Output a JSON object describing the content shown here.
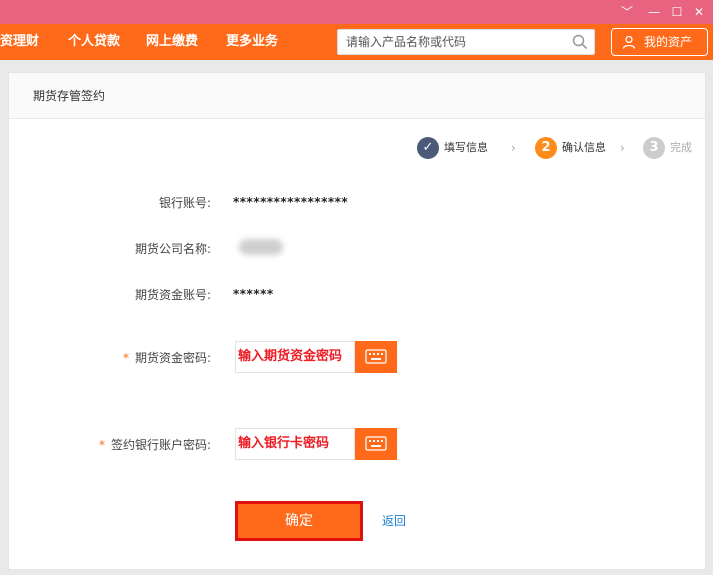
{
  "window": {
    "minimize": "﹀",
    "minimize2": "—",
    "maximize": "☐",
    "close": "✕"
  },
  "nav": {
    "items": [
      "资理财",
      "个人贷款",
      "网上缴费",
      "更多业务"
    ],
    "search_placeholder": "请输入产品名称或代码",
    "my_assets": "我的资产"
  },
  "page": {
    "section_title": "期货存管签约",
    "steps": [
      {
        "label": "填写信息",
        "state": "done",
        "symbol": "✓"
      },
      {
        "label": "确认信息",
        "state": "current",
        "symbol": "2"
      },
      {
        "label": "完成",
        "state": "pending",
        "symbol": "3"
      }
    ],
    "step_arrow": "›",
    "fields": [
      {
        "label": "银行账号:",
        "value": "*****************"
      },
      {
        "label": "期货公司名称:",
        "value": ""
      },
      {
        "label": "期货资金账号:",
        "value": "******"
      }
    ],
    "password_fields": [
      {
        "required_mark": "*",
        "label": "期货资金密码:",
        "placeholder": "输入期货资金密码"
      },
      {
        "required_mark": "*",
        "label": "签约银行账户密码:",
        "placeholder": "输入银行卡密码"
      }
    ],
    "confirm_label": "确定",
    "back_label": "返回"
  },
  "colors": {
    "titlebar": "#e8637f",
    "navbar": "#ff6a1a",
    "step_done": "#4a5a78",
    "step_current": "#ff8c1a",
    "step_pending": "#cccccc",
    "password_text": "#ee1c24",
    "confirm_border": "#e01010",
    "link": "#1a7fd6"
  }
}
